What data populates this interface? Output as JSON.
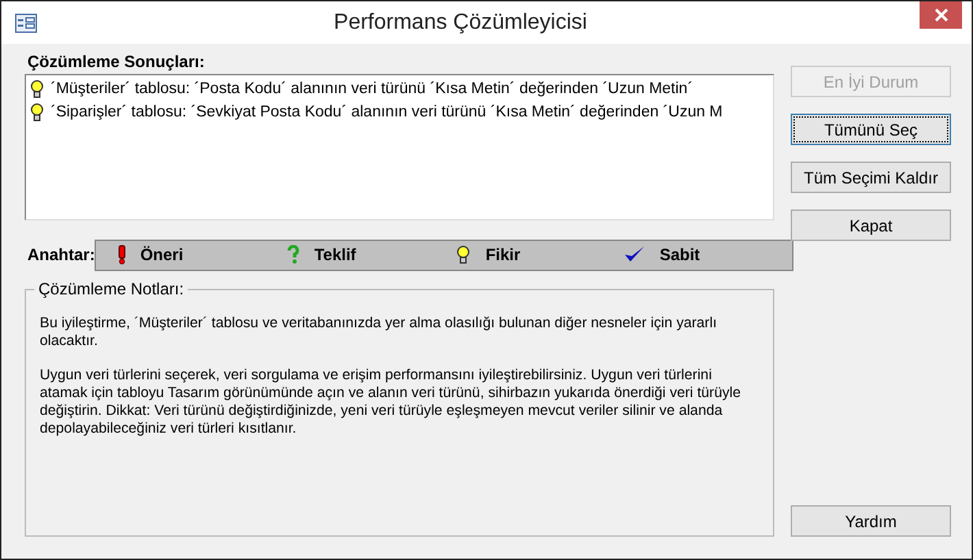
{
  "window": {
    "title": "Performans Çözümleyicisi"
  },
  "results": {
    "label": "Çözümleme Sonuçları:",
    "items": [
      {
        "kind": "idea",
        "text": "´Müşteriler´ tablosu: ´Posta Kodu´ alanının veri türünü ´Kısa Metin´ değerinden ´Uzun Metin´"
      },
      {
        "kind": "idea",
        "text": "´Siparişler´ tablosu: ´Sevkiyat Posta Kodu´ alanının veri türünü ´Kısa Metin´ değerinden ´Uzun M"
      }
    ]
  },
  "key": {
    "label": "Anahtar:",
    "items": [
      {
        "kind": "recommendation",
        "text": "Öneri"
      },
      {
        "kind": "suggestion",
        "text": "Teklif"
      },
      {
        "kind": "idea",
        "text": "Fikir"
      },
      {
        "kind": "fixed",
        "text": "Sabit"
      }
    ]
  },
  "notes": {
    "label": "Çözümleme Notları:",
    "paragraphs": [
      "Bu iyileştirme, ´Müşteriler´ tablosu ve veritabanınızda yer alma olasılığı bulunan diğer nesneler için yararlı olacaktır.",
      "Uygun veri türlerini seçerek, veri sorgulama ve erişim performansını iyileştirebilirsiniz. Uygun veri türlerini atamak için tabloyu Tasarım görünümünde açın ve alanın veri türünü, sihirbazın yukarıda önerdiği veri türüyle değiştirin. Dikkat: Veri türünü değiştirdiğinizde, yeni veri türüyle eşleşmeyen mevcut veriler silinir ve alanda depolayabileceğiniz veri türleri kısıtlanır."
    ]
  },
  "buttons": [
    {
      "label": "En İyi Durum",
      "disabled": true,
      "focused": false
    },
    {
      "label": "Tümünü Seç",
      "disabled": false,
      "focused": true
    },
    {
      "label": "Tüm Seçimi Kaldır",
      "disabled": false,
      "focused": false
    },
    {
      "label": "Kapat",
      "disabled": false,
      "focused": false
    }
  ],
  "help_button": {
    "label": "Yardım",
    "disabled": false,
    "focused": false
  }
}
